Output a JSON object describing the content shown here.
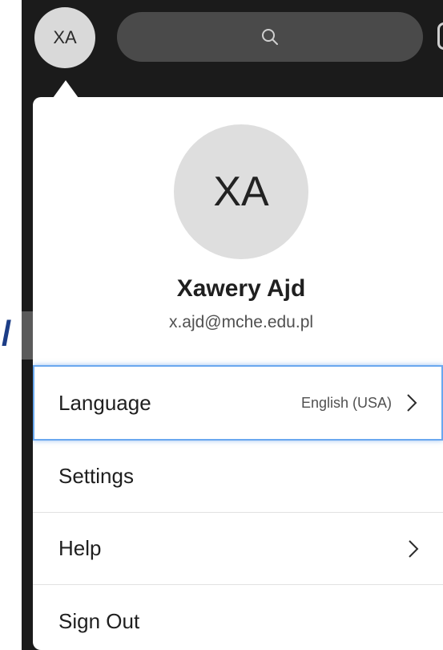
{
  "topbar": {
    "avatar_initials": "XA",
    "search_icon": "search-icon"
  },
  "profile": {
    "avatar_initials": "XA",
    "name": "Xawery Ajd",
    "email": "x.ajd@mche.edu.pl"
  },
  "menu": {
    "items": [
      {
        "label": "Language",
        "value": "English (USA)",
        "icon": "chevron-right-icon",
        "focused": true
      },
      {
        "label": "Settings"
      },
      {
        "label": "Help",
        "icon": "chevron-right-icon"
      },
      {
        "label": "Sign Out"
      }
    ]
  },
  "colors": {
    "app_background": "#1b1b1b",
    "search_pill": "#4a4a4a",
    "avatar_background": "#d9d9d9",
    "focus_ring": "#6aa8ef",
    "side_glyph": "#1c3d86"
  }
}
